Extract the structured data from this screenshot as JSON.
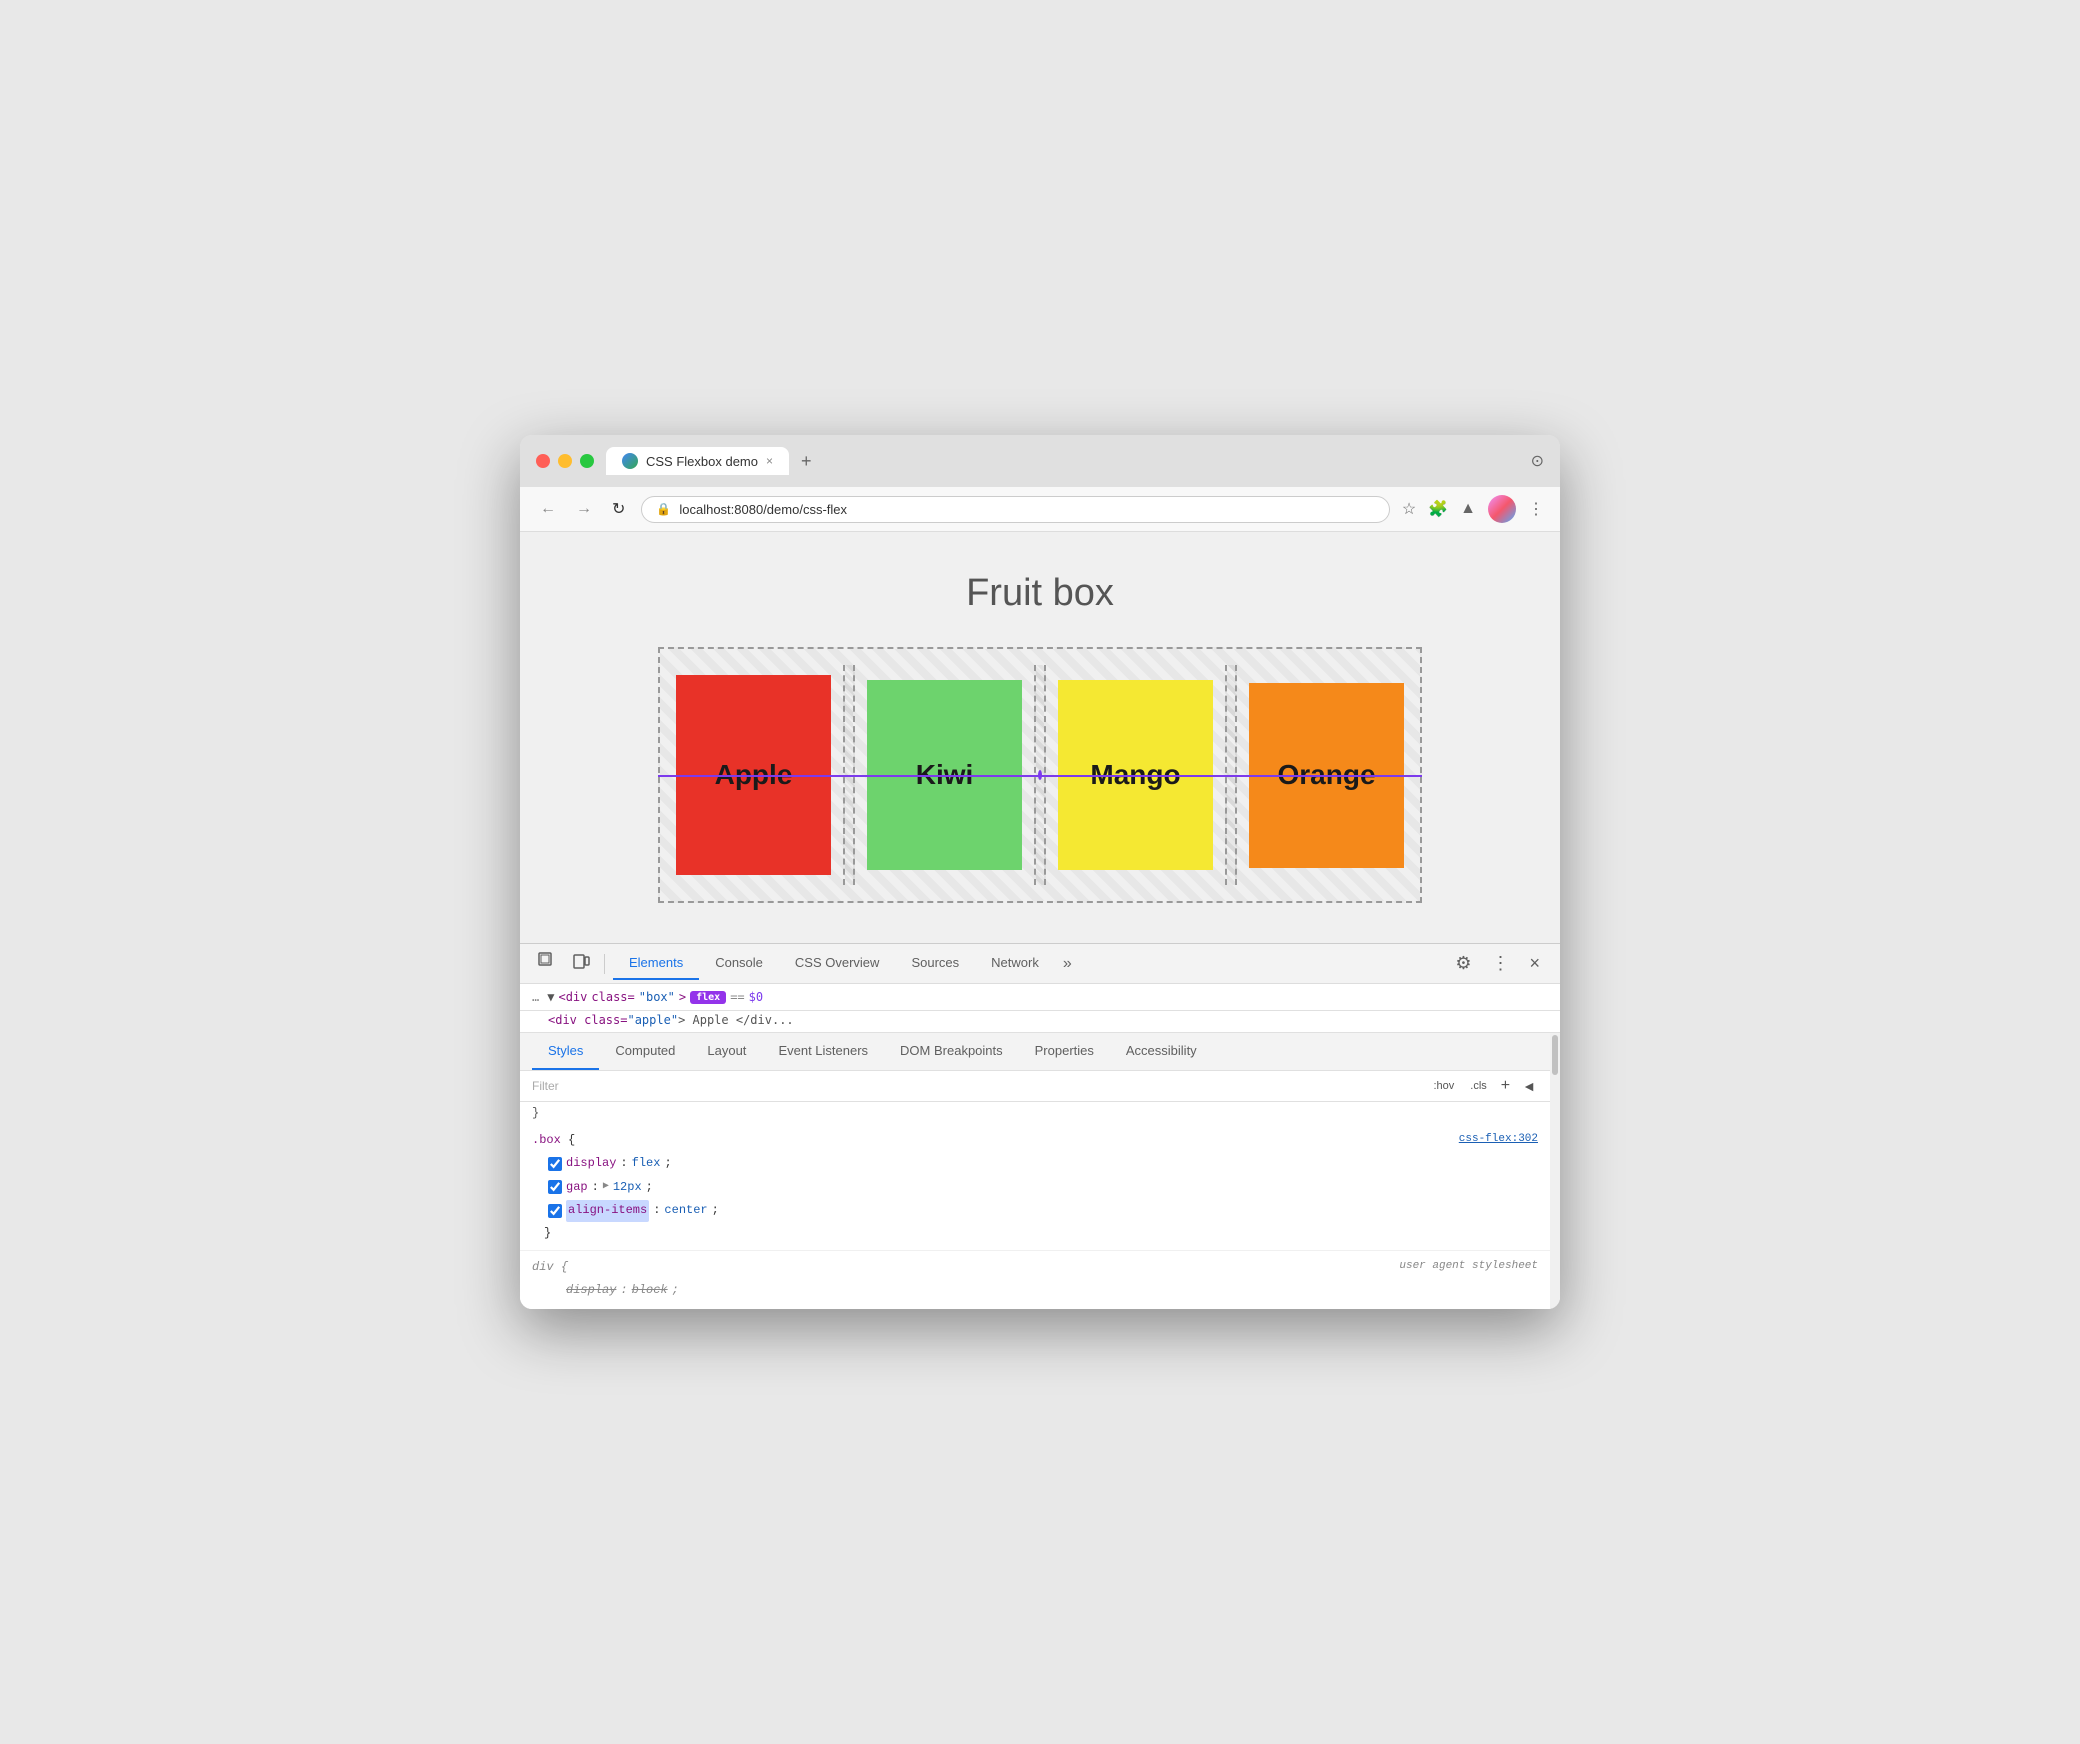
{
  "browser": {
    "tab_title": "CSS Flexbox demo",
    "tab_close": "×",
    "new_tab": "+",
    "address": "localhost:8080/demo/css-flex",
    "title_bar_icon": "⊙"
  },
  "nav": {
    "back": "←",
    "forward": "→",
    "reload": "↻"
  },
  "page": {
    "title": "Fruit box",
    "fruits": [
      {
        "label": "Apple",
        "color": "#e83228"
      },
      {
        "label": "Kiwi",
        "color": "#6dd36d"
      },
      {
        "label": "Mango",
        "color": "#f5e832"
      },
      {
        "label": "Orange",
        "color": "#f5891a"
      }
    ]
  },
  "devtools": {
    "tabs": [
      "Elements",
      "Console",
      "CSS Overview",
      "Sources",
      "Network",
      "»"
    ],
    "active_tab": "Elements",
    "gear_icon": "⚙",
    "menu_icon": "⋮",
    "close_icon": "×",
    "inspect_icon": "⬚",
    "device_icon": "▭"
  },
  "breadcrumb": {
    "dots": "…",
    "tag": "div",
    "class_attr": "class",
    "class_val": "\"box\"",
    "badge": "flex",
    "equals": "==",
    "dollar": "$0"
  },
  "styles_tabs": {
    "tabs": [
      "Styles",
      "Computed",
      "Layout",
      "Event Listeners",
      "DOM Breakpoints",
      "Properties",
      "Accessibility"
    ],
    "active_tab": "Styles"
  },
  "filter": {
    "placeholder": "Filter",
    "hov": ":hov",
    "cls": ".cls",
    "add": "+",
    "arrow": "◄"
  },
  "css_rules": {
    "empty_brace": "}",
    "box_rule": {
      "selector": ".box",
      "open": "{",
      "source": "css-flex:302",
      "properties": [
        {
          "name": "display",
          "value": "flex",
          "enabled": true,
          "highlighted": false
        },
        {
          "name": "gap",
          "value": "▶ 12px",
          "enabled": true,
          "highlighted": false,
          "has_triangle": true
        },
        {
          "name": "align-items",
          "value": "center",
          "enabled": true,
          "highlighted": true
        }
      ],
      "close": "}"
    },
    "div_rule": {
      "selector": "div",
      "open": "{",
      "source": "user agent stylesheet",
      "properties": [
        {
          "name": "display",
          "value": "block",
          "strikethrough": true
        }
      ],
      "close": "}"
    }
  }
}
